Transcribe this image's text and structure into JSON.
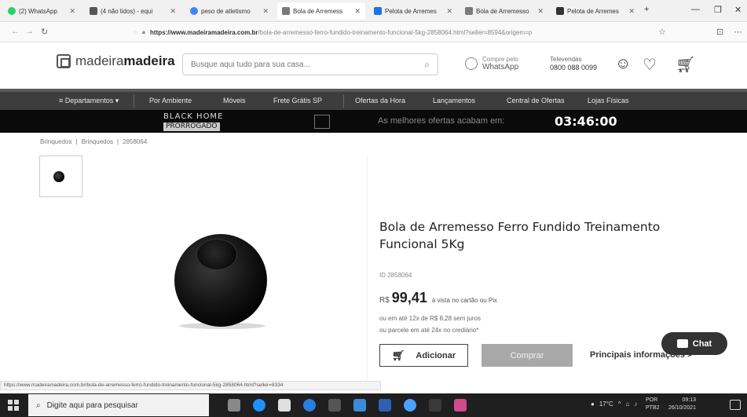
{
  "browser": {
    "tabs": [
      {
        "label": "(2) WhatsApp",
        "color": "#25d366"
      },
      {
        "label": "(4 não lidos) - equi",
        "color": "#555555"
      },
      {
        "label": "peso de atletismo",
        "color": "#4285f4"
      },
      {
        "label": "Bola de Arremess",
        "color": "#7a7a7a"
      },
      {
        "label": "Pelota de Arremes",
        "color": "#1a73e8"
      },
      {
        "label": "Bola de Arremesso",
        "color": "#7a7a7a"
      },
      {
        "label": "Pelota de Arremes",
        "color": "#333333"
      }
    ],
    "url_host": "https://www.madeiramadeira.com.br",
    "url_path": "/bola-de-arremesso-ferro-fundido-treinamento-funcional-5kg-2858064.html?seller=8594&origem=p"
  },
  "header": {
    "logo_light": "madeira",
    "logo_bold": "madeira",
    "search_placeholder": "Busque aqui tudo para sua casa...",
    "whatsapp_line1": "Compre pelo",
    "whatsapp_line2": "WhatsApp",
    "televendas_line1": "Televendas",
    "televendas_line2": "0800 088 0099"
  },
  "nav": {
    "items": [
      "≡  Departamentos ▾",
      "Por Ambiente",
      "Móveis",
      "Frete Grátis SP",
      "Ofertas da Hora",
      "Lançamentos",
      "Central de Ofertas",
      "Lojas Físicas"
    ]
  },
  "banner": {
    "logo_line1": "BLACK HOME",
    "logo_line2": "PRORROGADO",
    "text": "As melhores ofertas acabam em:",
    "timer": "03:46:00"
  },
  "breadcrumb": [
    "Brinquedos",
    "Brinquedos",
    "2858064"
  ],
  "product": {
    "title": "Bola de Arremesso Ferro Fundido Treinamento Funcional 5Kg",
    "id": "ID 2858064",
    "currency": "R$",
    "price": "99,41",
    "price_note": "à vista no cartão ou Pix",
    "installments": "ou em até 12x de R$ 8,28 sem juros",
    "installments2": "ou parcele em até 24x no crediário*",
    "add_label": "Adicionar",
    "buy_label": "Comprar",
    "info_label": "Principais informações >"
  },
  "chat": {
    "label": "Chat"
  },
  "status_url": "https://www.madeiramadeira.com.br/bola-de-arremesso-ferro-fundido-treinamento-funcional-5kg-2858064.html?seller=8334",
  "taskbar": {
    "search_placeholder": "Digite aqui para pesquisar",
    "weather": "17°C",
    "lang_line1": "POR",
    "lang_line2": "PTB2",
    "time": "09:13",
    "date": "26/10/2021",
    "app_colors": [
      "#888888",
      "#1e90ff",
      "#e0e0e0",
      "#2a7de1",
      "#555555",
      "#3b8bd8",
      "#2f5fb3",
      "#4aa3ff",
      "#3a3a3a",
      "#d04a8c"
    ]
  }
}
